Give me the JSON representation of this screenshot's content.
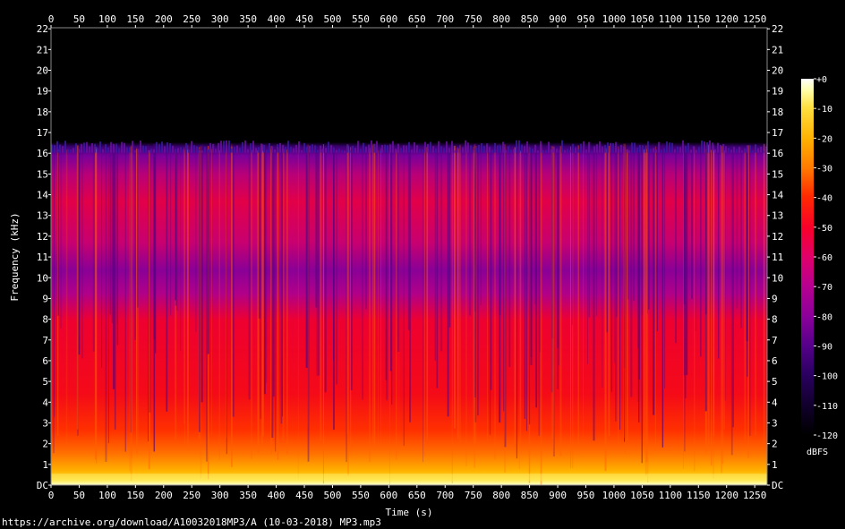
{
  "chart_data": {
    "type": "heatmap",
    "xlabel": "Time (s)",
    "ylabel": "Frequency (kHz)",
    "x_ticks": [
      "0",
      "50",
      "100",
      "150",
      "200",
      "250",
      "300",
      "350",
      "400",
      "450",
      "500",
      "550",
      "600",
      "650",
      "700",
      "750",
      "800",
      "850",
      "900",
      "950",
      "1000",
      "1050",
      "1100",
      "1150",
      "1200",
      "1250"
    ],
    "x_tick_values": [
      0,
      50,
      100,
      150,
      200,
      250,
      300,
      350,
      400,
      450,
      500,
      550,
      600,
      650,
      700,
      750,
      800,
      850,
      900,
      950,
      1000,
      1050,
      1100,
      1150,
      1200,
      1250
    ],
    "xlim": [
      0,
      1272
    ],
    "y_ticks": [
      "DC",
      "1",
      "2",
      "3",
      "4",
      "5",
      "6",
      "7",
      "8",
      "9",
      "10",
      "11",
      "12",
      "13",
      "14",
      "15",
      "16",
      "17",
      "18",
      "19",
      "20",
      "21",
      "22"
    ],
    "y_tick_values": [
      0,
      1,
      2,
      3,
      4,
      5,
      6,
      7,
      8,
      9,
      10,
      11,
      12,
      13,
      14,
      15,
      16,
      17,
      18,
      19,
      20,
      21,
      22
    ],
    "ylim": [
      0,
      22.05
    ],
    "lowpass_cutoff_khz": 16.2,
    "colorbar": {
      "label": "dBFS",
      "ticks": [
        "+0",
        "-10",
        "-20",
        "-30",
        "-40",
        "-50",
        "-60",
        "-70",
        "-80",
        "-90",
        "-100",
        "-110",
        "-120"
      ],
      "tick_values": [
        0,
        -10,
        -20,
        -30,
        -40,
        -50,
        -60,
        -70,
        -80,
        -90,
        -100,
        -110,
        -120
      ],
      "range": [
        -120,
        0
      ],
      "colormap": [
        "#000000",
        "#10002a",
        "#2a0060",
        "#55008a",
        "#8a009a",
        "#b80090",
        "#e0006a",
        "#f8002a",
        "#ff2a00",
        "#ff7a00",
        "#ffb000",
        "#ffe040",
        "#ffffb0",
        "#ffffff"
      ]
    },
    "regions": [
      {
        "freq_khz": [
          0,
          0.5
        ],
        "level_dbfs": -15
      },
      {
        "freq_khz": [
          0.5,
          3
        ],
        "level_dbfs": -35
      },
      {
        "freq_khz": [
          3,
          8
        ],
        "level_dbfs": -50
      },
      {
        "freq_khz": [
          8,
          11
        ],
        "level_dbfs": -65
      },
      {
        "freq_khz": [
          11,
          14
        ],
        "level_dbfs": -60
      },
      {
        "freq_khz": [
          14,
          16.2
        ],
        "level_dbfs": -68
      },
      {
        "freq_khz": [
          16.2,
          22.05
        ],
        "level_dbfs": -120
      }
    ]
  },
  "source_caption": "https://archive.org/download/A10032018MP3/A (10-03-2018) MP3.mp3"
}
